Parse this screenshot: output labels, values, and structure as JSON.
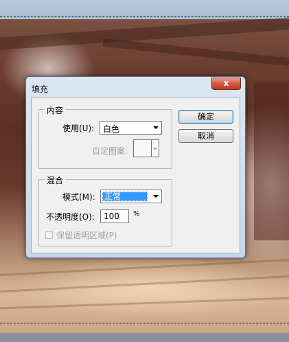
{
  "dialog": {
    "title": "填充",
    "close_glyph": "x",
    "content_group": {
      "label": "内容",
      "use_label": "使用(U):",
      "use_value": "白色",
      "custom_pattern_label": "自定图案:"
    },
    "blend_group": {
      "label": "混合",
      "mode_label": "模式(M):",
      "mode_value": "正常",
      "opacity_label": "不透明度(O):",
      "opacity_value": "100",
      "opacity_unit": "%",
      "preserve_transparency_label": "保留透明区域(P)",
      "preserve_transparency_checked": false
    },
    "buttons": {
      "ok": "确定",
      "cancel": "取消"
    }
  },
  "colors": {
    "selection": "#3399ff",
    "close_button": "#c9462d",
    "dialog_frame": "#c8d8ea",
    "client_bg": "#f0f0f0"
  }
}
